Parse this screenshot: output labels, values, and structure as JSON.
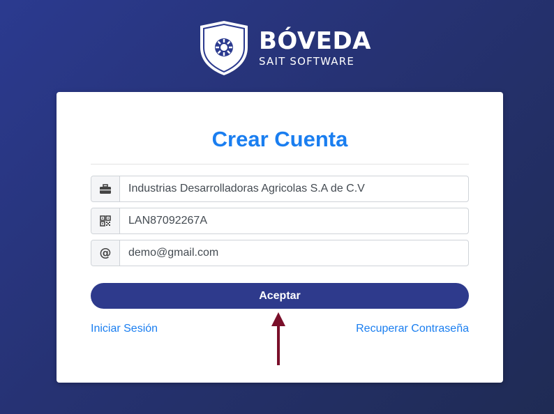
{
  "brand": {
    "name": "BÓVEDA",
    "subtitle": "SAIT SOFTWARE"
  },
  "form": {
    "title": "Crear Cuenta",
    "fields": [
      {
        "icon": "briefcase-icon",
        "value": "Industrias Desarrolladoras Agricolas S.A de C.V"
      },
      {
        "icon": "qr-code-icon",
        "value": "LAN87092267A"
      },
      {
        "icon": "at-sign-icon",
        "value": "demo@gmail.com"
      }
    ],
    "submit_label": "Aceptar",
    "login_link": "Iniciar Sesión",
    "recover_link": "Recuperar Contraseña"
  },
  "colors": {
    "title": "#1a7ef0",
    "button": "#2e3a8c",
    "link": "#1a7ef0",
    "annotation_arrow": "#7a0f2a"
  }
}
